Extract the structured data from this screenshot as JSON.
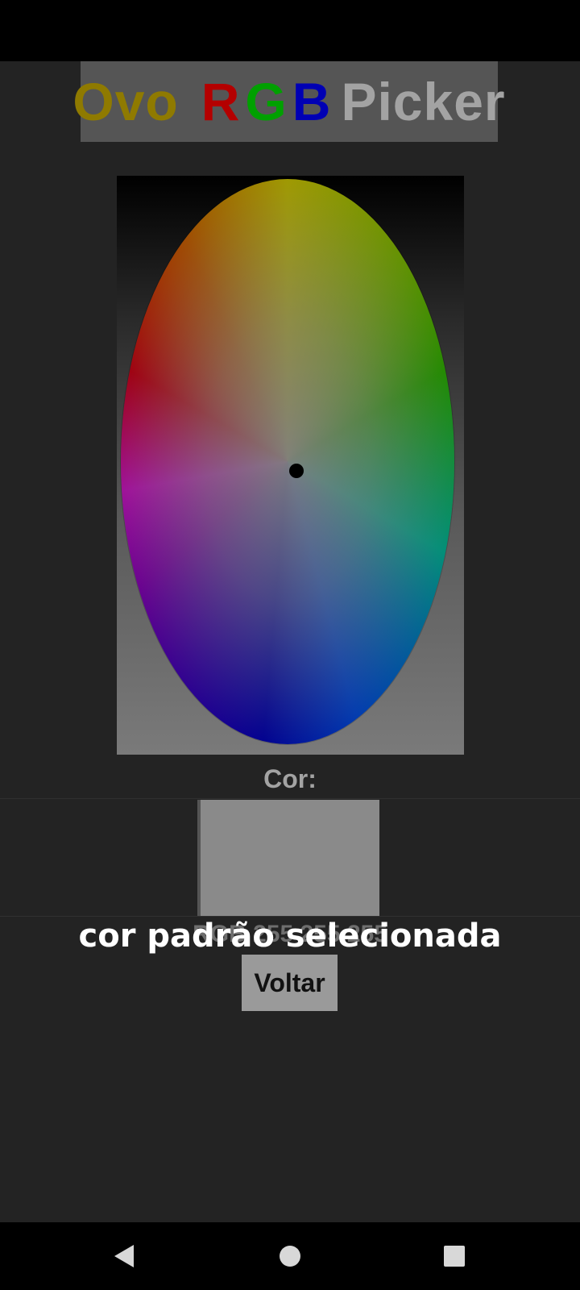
{
  "header": {
    "title_part_ovo": "Ovo",
    "title_part_r": "R",
    "title_part_g": "G",
    "title_part_b": "B",
    "title_part_picker": "Picker",
    "colors": {
      "ovo": "#8f7a00",
      "r": "#b40000",
      "g": "#00a000",
      "b": "#0000b4",
      "picker": "#a3a3a3",
      "banner_bg": "#555555"
    }
  },
  "picker": {
    "selected_color_label": "Cor:",
    "rgb_value": "RGB 255 255 255",
    "swatch_color": "#8a8a8a"
  },
  "toast": {
    "message": "cor padrão selecionada"
  },
  "actions": {
    "back_label": "Voltar"
  },
  "navigation": {
    "back_icon": "back-triangle-icon",
    "home_icon": "home-circle-icon",
    "recents_icon": "recents-square-icon"
  }
}
